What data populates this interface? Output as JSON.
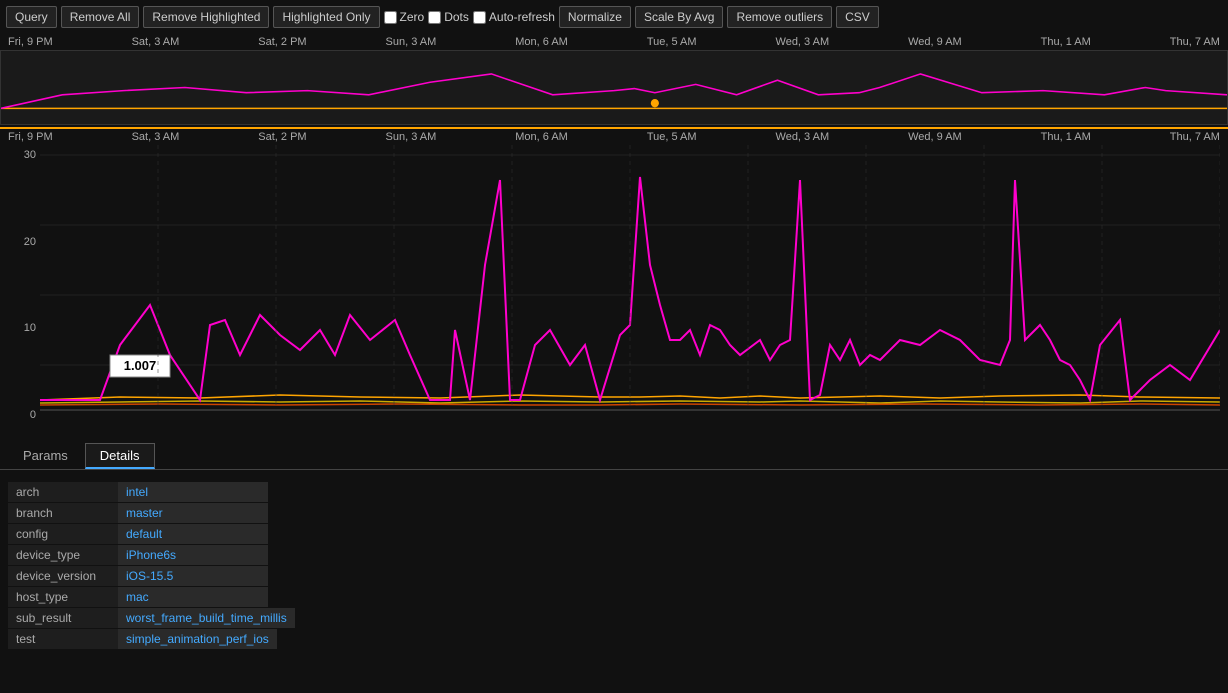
{
  "toolbar": {
    "query_label": "Query",
    "remove_all_label": "Remove All",
    "remove_highlighted_label": "Remove Highlighted",
    "highlighted_only_label": "Highlighted Only",
    "zero_label": "Zero",
    "dots_label": "Dots",
    "auto_refresh_label": "Auto-refresh",
    "normalize_label": "Normalize",
    "scale_by_avg_label": "Scale By Avg",
    "remove_outliers_label": "Remove outliers",
    "csv_label": "CSV"
  },
  "chart": {
    "x_labels": [
      "Fri, 9 PM",
      "Sat, 3 AM",
      "Sat, 2 PM",
      "Sun, 3 AM",
      "Mon, 6 AM",
      "Tue, 5 AM",
      "Wed, 3 AM",
      "Wed, 9 AM",
      "Thu, 1 AM",
      "Thu, 7 AM"
    ],
    "y_labels": [
      "30",
      "20",
      "10",
      "0"
    ],
    "tooltip_value": "1.007"
  },
  "tabs": {
    "params_label": "Params",
    "details_label": "Details",
    "active": "Details"
  },
  "details": {
    "rows": [
      {
        "key": "arch",
        "value": "intel"
      },
      {
        "key": "branch",
        "value": "master"
      },
      {
        "key": "config",
        "value": "default"
      },
      {
        "key": "device_type",
        "value": "iPhone6s"
      },
      {
        "key": "device_version",
        "value": "iOS-15.5"
      },
      {
        "key": "host_type",
        "value": "mac"
      },
      {
        "key": "sub_result",
        "value": "worst_frame_build_time_millis"
      },
      {
        "key": "test",
        "value": "simple_animation_perf_ios"
      }
    ]
  }
}
